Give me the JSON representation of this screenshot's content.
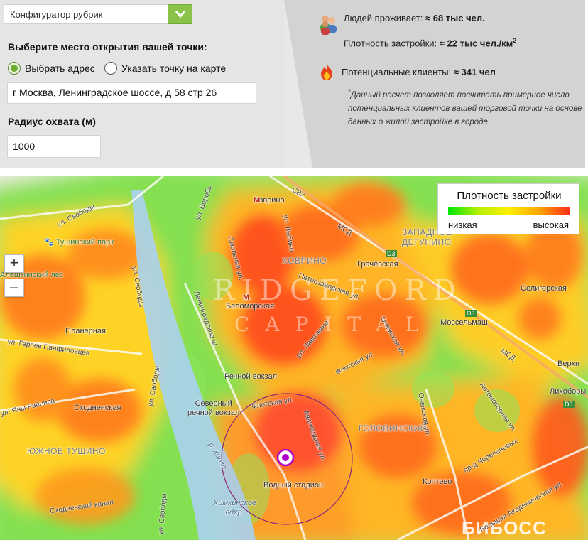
{
  "colors": {
    "accent": "#8bc34a",
    "target": "#b000c8",
    "heat_high": "#ff2a1a",
    "heat_low": "#00e600"
  },
  "rubric_select": {
    "value": "Конфигуратор рубрик",
    "icon": "chevron-down-icon"
  },
  "location": {
    "title": "Выберите место открытия вашей точки:",
    "option_address": "Выбрать адрес",
    "option_map": "Указать точку на карте",
    "selected": "address",
    "address_value": "г Москва, Ленинградское шоссе, д 58 стр 26"
  },
  "radius": {
    "title": "Радиус охвата (м)",
    "value": "1000"
  },
  "stats": {
    "people_icon": "people-icon",
    "people_label": "Людей проживает:",
    "people_value": "≈ 68 тыс чел.",
    "density_label": "Плотность застройки:",
    "density_value": "≈ 22 тыс чел./км",
    "density_sup": "2",
    "clients_icon": "flame-icon",
    "clients_label": "Потенциальные клиенты:",
    "clients_value": "≈ 341 чел",
    "note_star": "*",
    "note": "Данный расчет позволяет посчитать примерное число потенциальных клиентов вашей торговой точки на основе данных о жилой застройке в городе"
  },
  "legend": {
    "title": "Плотность застройки",
    "low": "низкая",
    "high": "высокая"
  },
  "map": {
    "zoom_in": "+",
    "zoom_out": "–",
    "watermark_top": "RIDGEFORD",
    "watermark_bottom": "CAPITAL",
    "brand": "БИБОСС",
    "labels": {
      "khovrino": "Ховрино",
      "khovrino_district": "ХОВРИНО",
      "zapadnoe_degunino": "ЗАПАДНОЕ ДЕГУНИНО",
      "tushinsky_park": "Тушинский парк",
      "aleshkinsky_les": "Алешкинский лес",
      "belomorskaya": "Беломорская",
      "grachevskaya": "Грачёвская",
      "seligerskaya": "Селигерская",
      "mosselmash": "Моссельмаш",
      "planernaya": "Планерная",
      "rechnoy_vokzal": "Речной вокзал",
      "north_terminal_1": "Северный",
      "north_terminal_2": "речной вокзал",
      "skhodnenskaya": "Сходненская",
      "yuzhnoe_tushino": "ЮЖНОЕ ТУШИНО",
      "golovinsky": "ГОЛОВИНСКИЙ",
      "vodny_stadion": "Водный стадион",
      "koptevo": "Коптево",
      "likhobory": "Лихоборы",
      "verkh": "Верхн",
      "khimki_1": "Химкинское",
      "khimki_2": "вдхр.",
      "svh": "СВХ",
      "msd": "МСД",
      "msd2": "МСД",
      "d3": "D3",
      "d3b": "D3",
      "d3c": "D3",
      "ul_svobody_top": "ул. Свободы",
      "ul_svobody_mid": "ул. Свободы",
      "ul_svobody_bot": "ул. Свободы",
      "ul_svobody_low": "ул. Свободы",
      "geroev": "ул. Героев Панфиловцев",
      "raisa": "ул. Яны Райниса",
      "leningradskoe": "Ленинградское ш.",
      "flotskaya": "Флотская ул.",
      "flotskaya2": "Флотская ул.",
      "avangardnaya": "Авангардная ул.",
      "onezhskaya": "Онежская ул.",
      "onezhskaya2": "Онежская ул.",
      "smolnaya": "Смольная ул.",
      "petrozavodskaya": "Петрозаводская ул.",
      "lavochkina": "ул. Лавочкина",
      "lyblino": "ул. Лыбино",
      "avtomotornaya": "Автомоторная ул.",
      "cherepanovykh": "пр-д Черепановых",
      "skhodnensky_kanal": "Сходненский канал",
      "bolshaya_akademicheskaya": "Большая Академическая ул.",
      "khimka_river": "р. Химка",
      "vorob": "ул. Воробь"
    }
  }
}
